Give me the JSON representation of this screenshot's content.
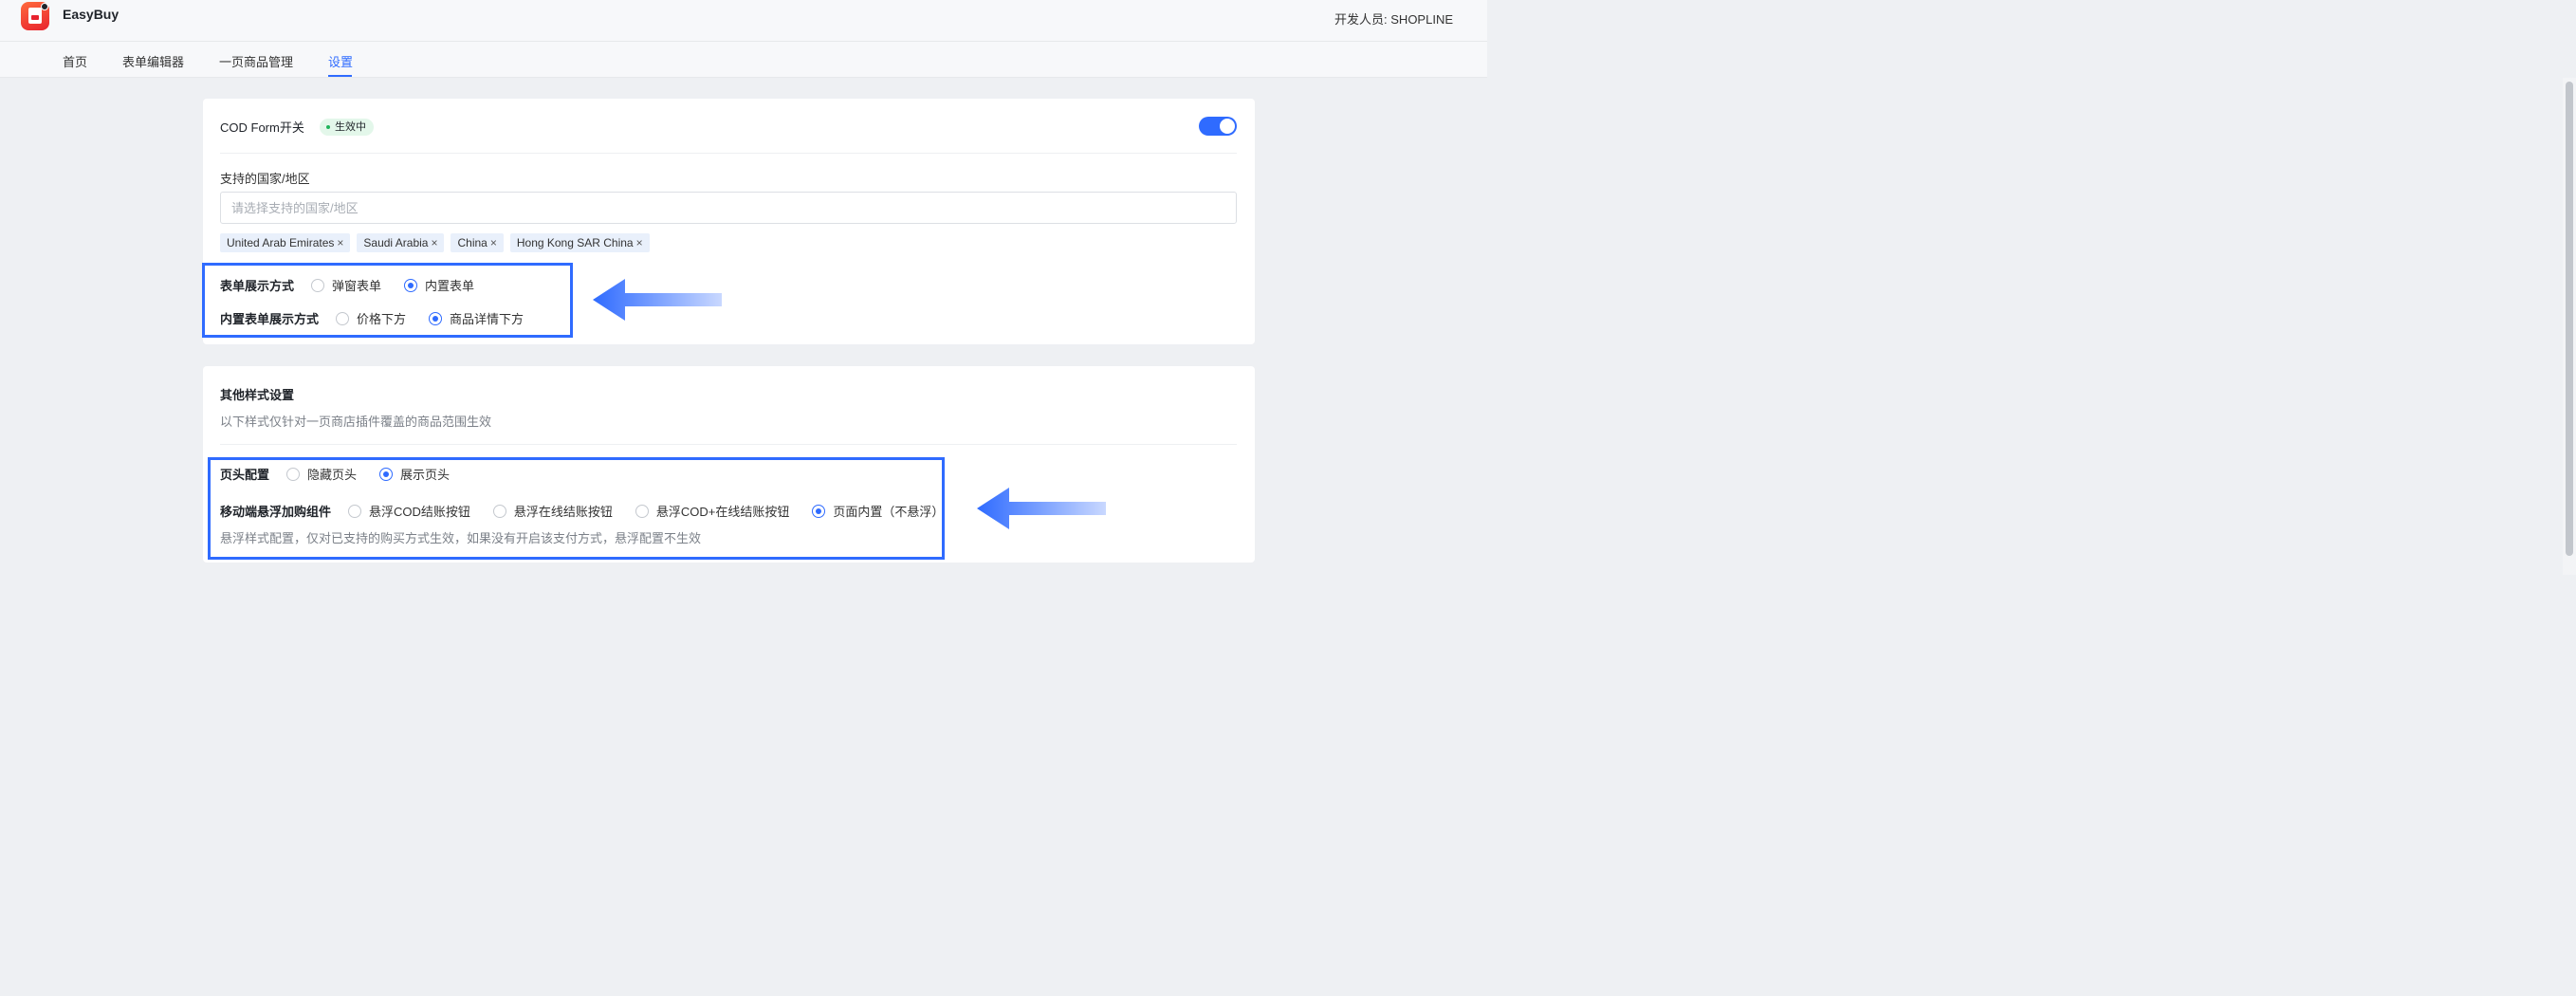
{
  "app": {
    "name": "EasyBuy",
    "developer": "开发人员: SHOPLINE"
  },
  "nav": {
    "tabs": [
      {
        "label": "首页",
        "active": false
      },
      {
        "label": "表单编辑器",
        "active": false
      },
      {
        "label": "一页商品管理",
        "active": false
      },
      {
        "label": "设置",
        "active": true
      }
    ]
  },
  "cod_card": {
    "title": "COD Form开关",
    "status_badge": "生效中",
    "toggle_on": true,
    "regions_label": "支持的国家/地区",
    "regions_placeholder": "请选择支持的国家/地区",
    "selected_regions": [
      "United Arab Emirates",
      "Saudi Arabia",
      "China",
      "Hong Kong SAR China"
    ],
    "tag_close_glyph": "×",
    "display_mode": {
      "label": "表单展示方式",
      "options": [
        "弹窗表单",
        "内置表单"
      ],
      "selected": "内置表单"
    },
    "embedded_position": {
      "label": "内置表单展示方式",
      "options": [
        "价格下方",
        "商品详情下方"
      ],
      "selected": "商品详情下方"
    }
  },
  "style_card": {
    "title": "其他样式设置",
    "description": "以下样式仅针对一页商店插件覆盖的商品范围生效",
    "header_config": {
      "label": "页头配置",
      "options": [
        "隐藏页头",
        "展示页头"
      ],
      "selected": "展示页头"
    },
    "mobile_floating": {
      "label": "移动端悬浮加购组件",
      "options": [
        "悬浮COD结账按钮",
        "悬浮在线结账按钮",
        "悬浮COD+在线结账按钮",
        "页面内置（不悬浮）"
      ],
      "selected": "页面内置（不悬浮）"
    },
    "footnote": "悬浮样式配置，仅对已支持的购买方式生效，如果没有开启该支付方式，悬浮配置不生效"
  },
  "colors": {
    "accent": "#2f6bff",
    "status_green": "#20b45b",
    "annotation_blue": "#2f6bff"
  }
}
